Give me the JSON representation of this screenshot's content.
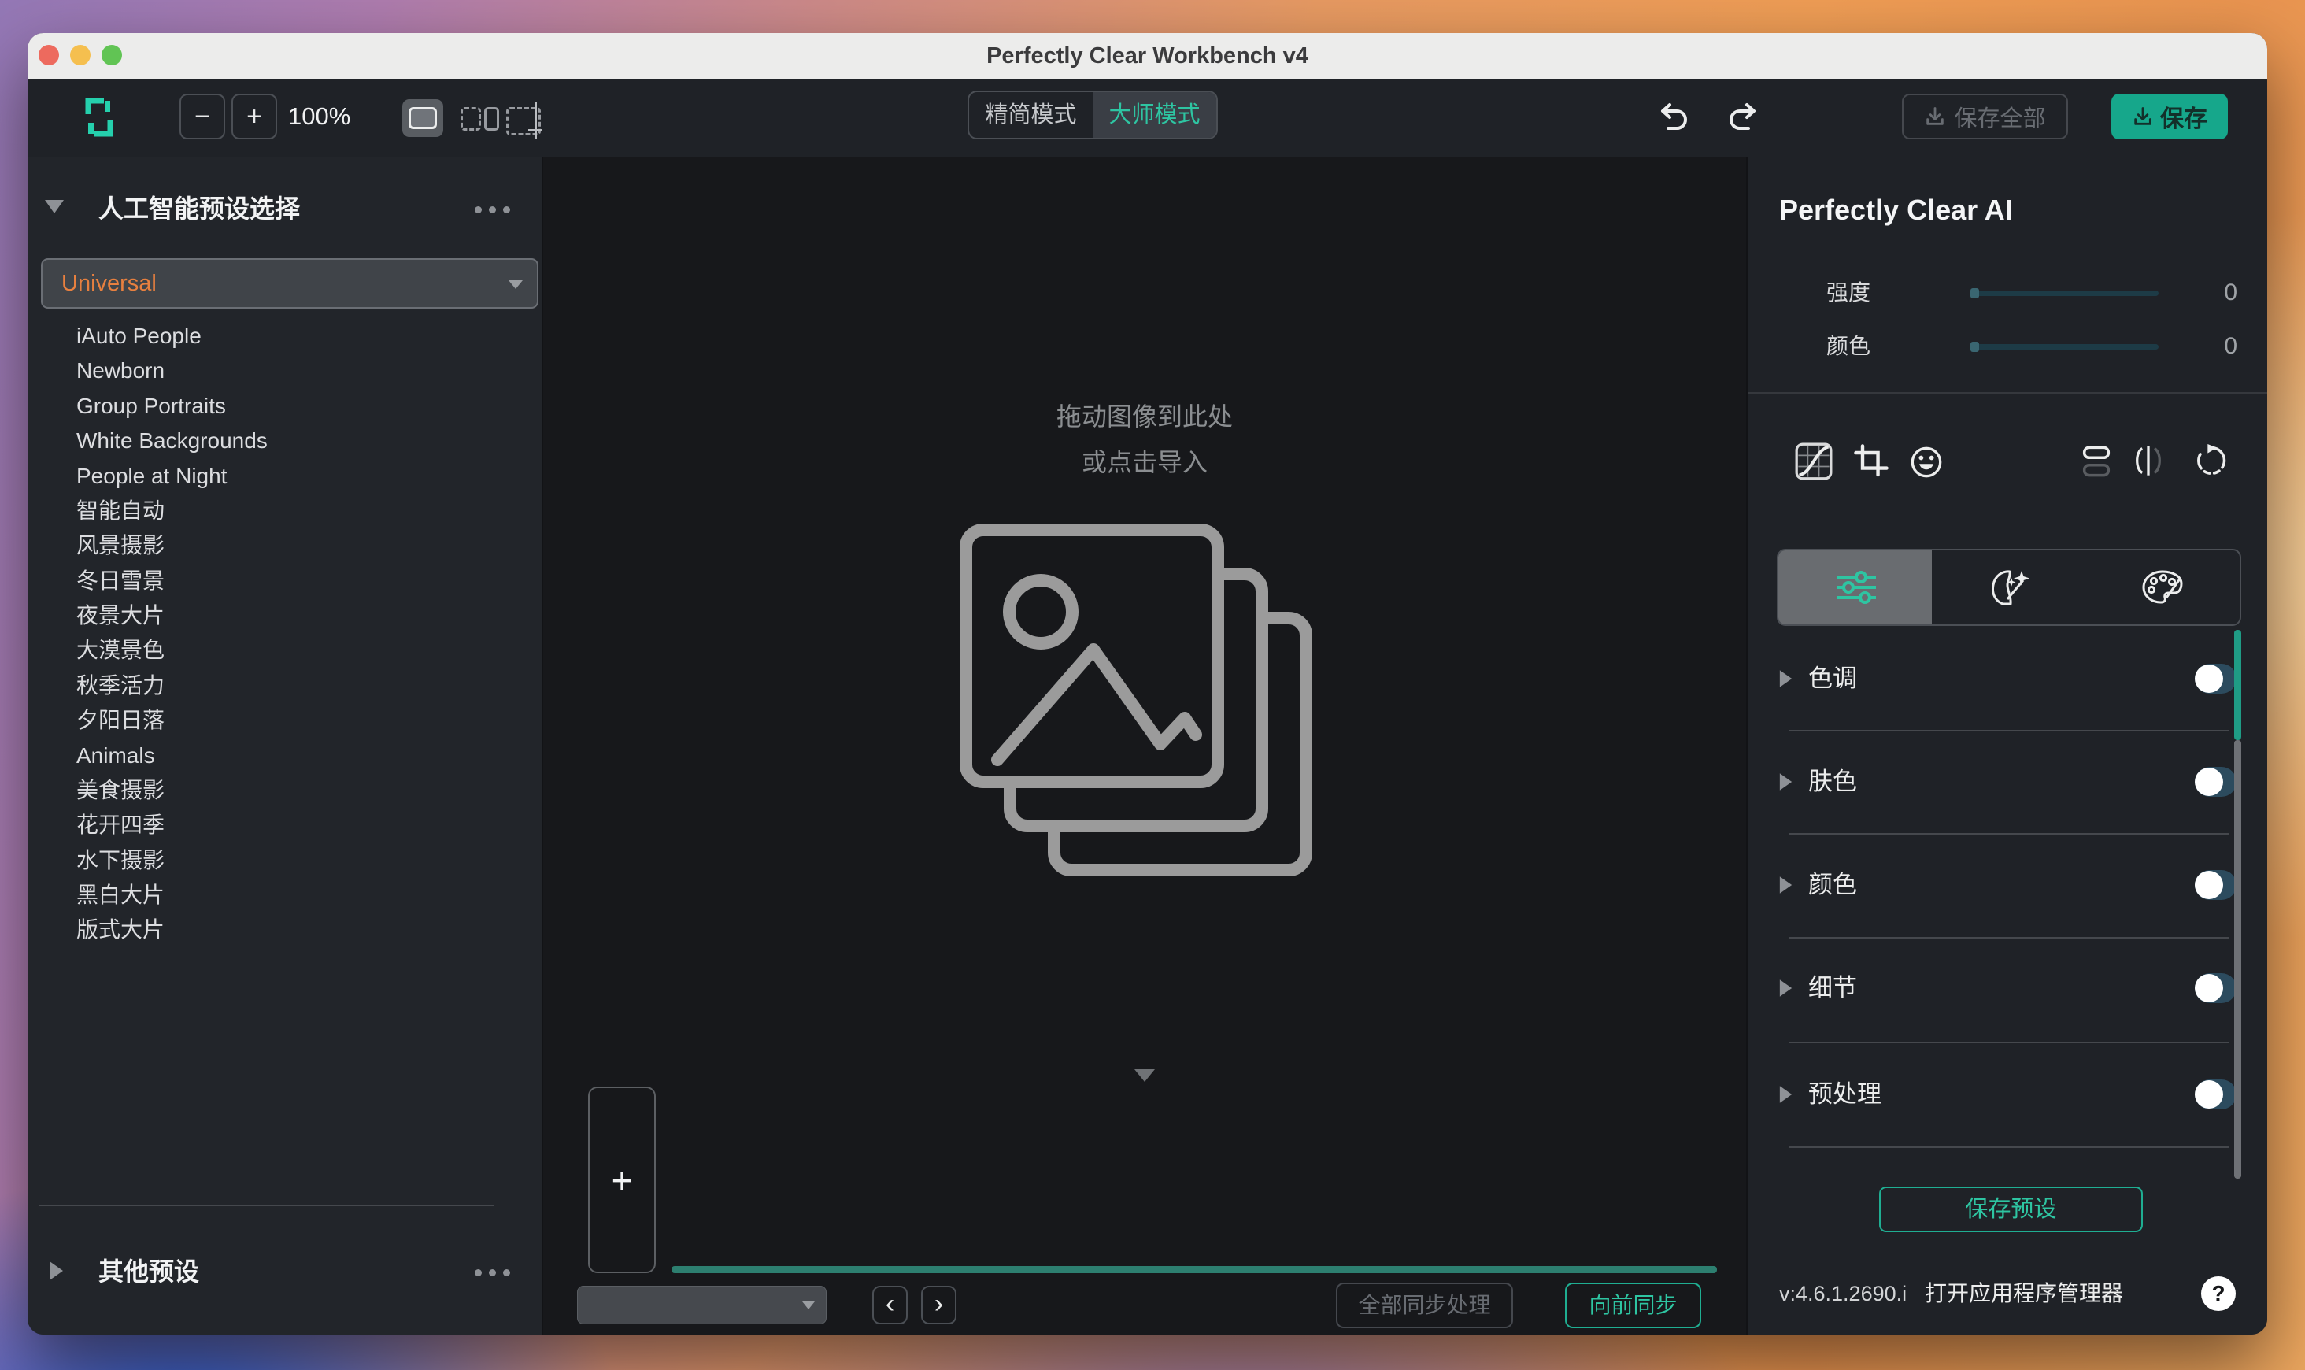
{
  "window": {
    "title": "Perfectly Clear Workbench v4"
  },
  "toolbar": {
    "zoom_out": "−",
    "zoom_in": "+",
    "zoom_level": "100%",
    "mode_simple": "精简模式",
    "mode_master": "大师模式",
    "save_all_label": "保存全部",
    "save_label": "保存"
  },
  "sidebar": {
    "header": "人工智能预设选择",
    "dropdown_value": "Universal",
    "presets": [
      "iAuto People",
      "Newborn",
      "Group Portraits",
      "White Backgrounds",
      "People at Night",
      "智能自动",
      "风景摄影",
      "冬日雪景",
      "夜景大片",
      "大漠景色",
      "秋季活力",
      "夕阳日落",
      "Animals",
      "美食摄影",
      "花开四季",
      "水下摄影",
      "黑白大片",
      "版式大片"
    ],
    "other_header": "其他预设"
  },
  "canvas": {
    "drop_line1": "拖动图像到此处",
    "drop_line2": "或点击导入",
    "add_label": "+"
  },
  "filmstrip": {
    "prev": "‹",
    "next": "›",
    "sync_all_label": "全部同步处理",
    "sync_forward_label": "向前同步"
  },
  "right_panel": {
    "title": "Perfectly Clear AI",
    "sliders": [
      {
        "label": "强度",
        "value": "0"
      },
      {
        "label": "颜色",
        "value": "0"
      }
    ],
    "sections": [
      {
        "label": "色调",
        "state": "off"
      },
      {
        "label": "肤色",
        "state": "off"
      },
      {
        "label": "颜色",
        "state": "off"
      },
      {
        "label": "细节",
        "state": "off"
      },
      {
        "label": "预处理",
        "state": "off"
      }
    ],
    "save_preset_label": "保存预设",
    "version": "v:4.6.1.2690.i",
    "app_manager_label": "打开应用程序管理器",
    "help_label": "?"
  },
  "icons": {
    "logo": "perfectly-clear-logo",
    "tab1": "adjustments-sliders-icon",
    "tab2": "face-retouch-icon",
    "tab3": "palette-icon"
  },
  "colors": {
    "accent_teal": "#16a78b",
    "teal_text": "#2ec5a2",
    "orange_text": "#e8803f",
    "toggle_track": "#2c4b5e",
    "slider_track": "#1d3b46",
    "panel_bg": "#1f2227",
    "canvas_bg": "#17181b"
  }
}
